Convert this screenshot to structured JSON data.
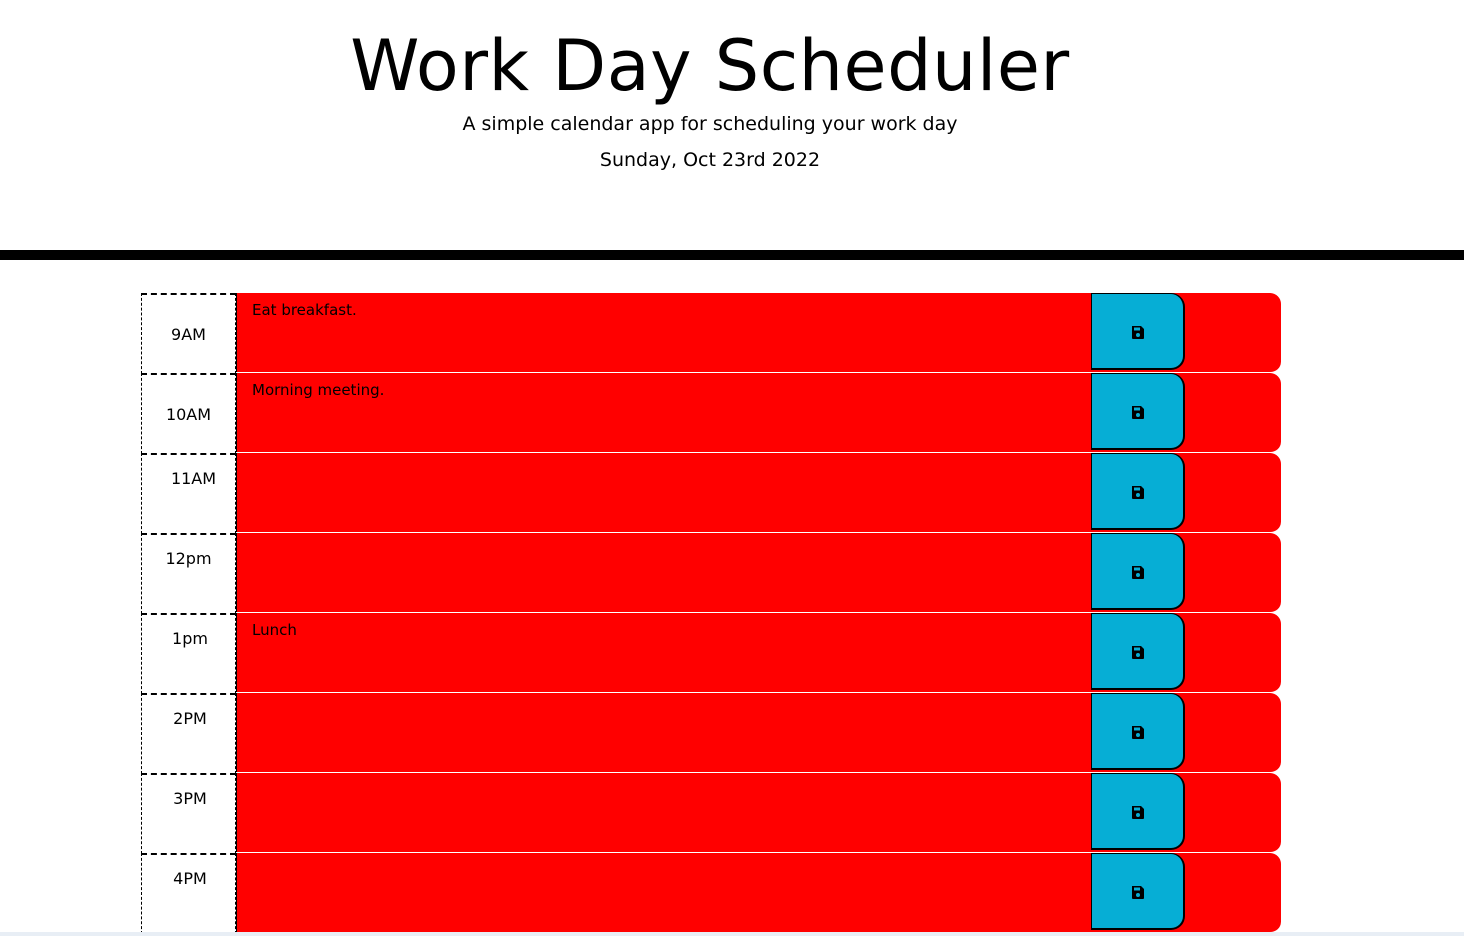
{
  "header": {
    "title": "Work Day Scheduler",
    "subtitle": "A simple calendar app for scheduling your work day",
    "current_day": "Sunday, Oct 23rd 2022"
  },
  "colors": {
    "past": "#ff0000",
    "save_button": "#06aed5",
    "divider": "#000000"
  },
  "time_blocks": [
    {
      "hour": "9AM",
      "text": "Eat breakfast.",
      "icon": "save-icon"
    },
    {
      "hour": "10AM",
      "text": "Morning meeting.",
      "icon": "save-icon"
    },
    {
      "hour": "11AM",
      "text": "",
      "icon": "save-icon"
    },
    {
      "hour": "12pm",
      "text": "",
      "icon": "save-icon"
    },
    {
      "hour": "1pm",
      "text": "Lunch",
      "icon": "save-icon"
    },
    {
      "hour": "2PM",
      "text": "",
      "icon": "save-icon"
    },
    {
      "hour": "3PM",
      "text": "",
      "icon": "save-icon"
    },
    {
      "hour": "4PM",
      "text": "",
      "icon": "save-icon"
    }
  ]
}
